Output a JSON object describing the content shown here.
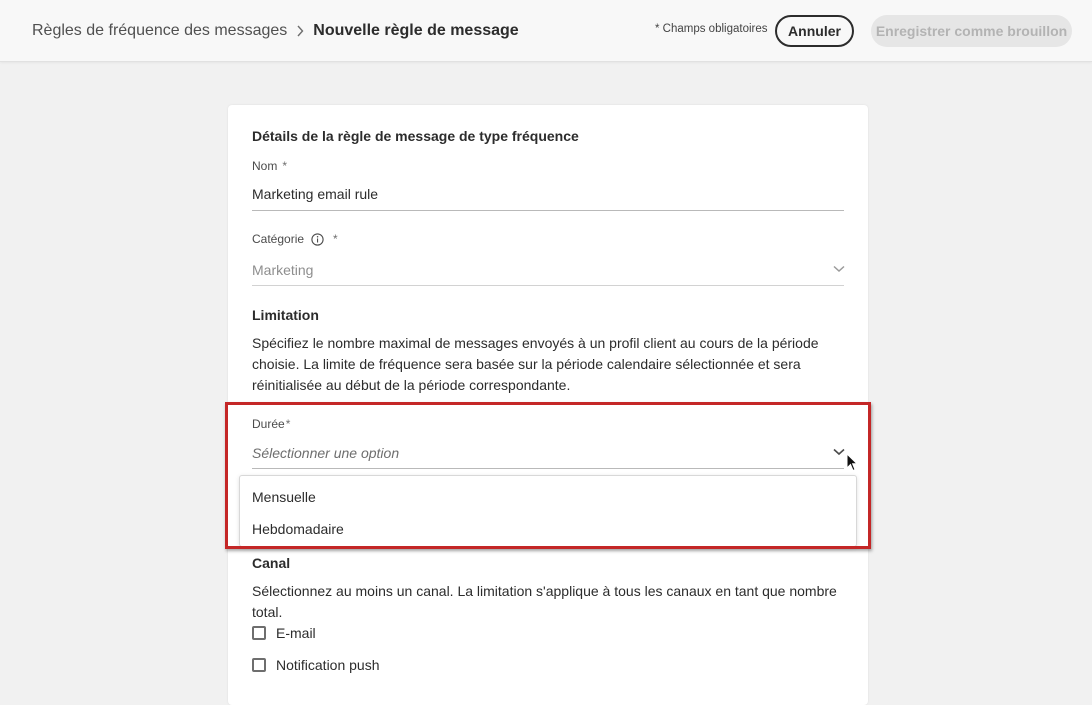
{
  "header": {
    "breadcrumb_parent": "Règles de fréquence des messages",
    "breadcrumb_separator": "›",
    "breadcrumb_current": "Nouvelle règle de message",
    "required_note": "* Champs obligatoires",
    "cancel_label": "Annuler",
    "save_label": "Enregistrer comme brouillon"
  },
  "form": {
    "section_title": "Détails de la règle de message de type fréquence",
    "name": {
      "label": "Nom",
      "required_mark": "*",
      "value": "Marketing email rule"
    },
    "category": {
      "label": "Catégorie",
      "required_mark": "*",
      "value": "Marketing"
    },
    "limitation": {
      "title": "Limitation",
      "description": "Spécifiez le nombre maximal de messages envoyés à un profil client au cours de la période choisie. La limite de fréquence sera basée sur la période calendaire sélectionnée et sera réinitialisée au début de la période correspondante."
    },
    "duration": {
      "label": "Durée",
      "required_mark": "*",
      "placeholder": "Sélectionner une option",
      "options": [
        "Mensuelle",
        "Hebdomadaire"
      ]
    },
    "channel": {
      "title": "Canal",
      "description": "Sélectionnez au moins un canal. La limitation s'applique à tous les canaux en tant que nombre total.",
      "options": [
        {
          "label": "E-mail",
          "checked": false
        },
        {
          "label": "Notification push",
          "checked": false
        }
      ]
    }
  },
  "colors": {
    "highlight": "#c42727",
    "background": "#f1f1f1",
    "card": "#ffffff"
  }
}
